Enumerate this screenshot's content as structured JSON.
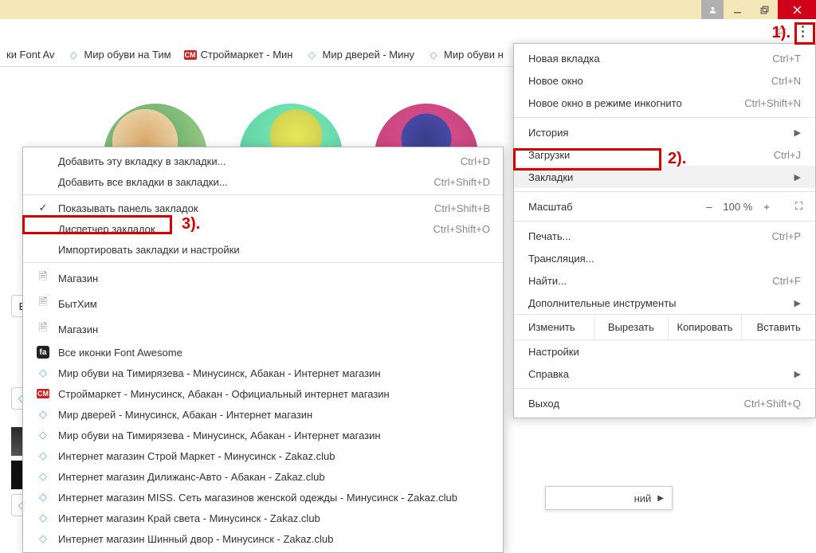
{
  "titlebar": {},
  "urlbar": {},
  "bookmarks_bar": [
    {
      "label": "ки Font Av",
      "icon": "page"
    },
    {
      "label": "Мир обуви на Тим",
      "icon": "diamond"
    },
    {
      "label": "Строймаркет - Мин",
      "icon": "cm"
    },
    {
      "label": "Мир дверей - Мину",
      "icon": "diamond"
    },
    {
      "label": "Мир обуви н",
      "icon": "diamond"
    }
  ],
  "chrome_menu": {
    "new_tab": "Новая вкладка",
    "new_tab_sc": "Ctrl+T",
    "new_window": "Новое окно",
    "new_window_sc": "Ctrl+N",
    "incognito": "Новое окно в режиме инкогнито",
    "incognito_sc": "Ctrl+Shift+N",
    "history": "История",
    "downloads": "Загрузки",
    "downloads_sc": "Ctrl+J",
    "bookmarks": "Закладки",
    "zoom_label": "Масштаб",
    "zoom_value": "100 %",
    "print": "Печать...",
    "print_sc": "Ctrl+P",
    "cast": "Трансляция...",
    "find": "Найти...",
    "find_sc": "Ctrl+F",
    "more_tools": "Дополнительные инструменты",
    "edit_label": "Изменить",
    "cut": "Вырезать",
    "copy": "Копировать",
    "paste": "Вставить",
    "settings": "Настройки",
    "help": "Справка",
    "exit": "Выход",
    "exit_sc": "Ctrl+Shift+Q"
  },
  "bookmarks_menu": {
    "add_tab": "Добавить эту вкладку в закладки...",
    "add_tab_sc": "Ctrl+D",
    "add_all": "Добавить все вкладки в закладки...",
    "add_all_sc": "Ctrl+Shift+D",
    "show_bar": "Показывать панель закладок",
    "show_bar_sc": "Ctrl+Shift+B",
    "manager": "Диспетчер закладок",
    "manager_sc": "Ctrl+Shift+O",
    "import": "Импортировать закладки и настройки",
    "items": [
      {
        "icon": "page",
        "label": "Магазин"
      },
      {
        "icon": "page",
        "label": "БытХим"
      },
      {
        "icon": "page",
        "label": "Магазин"
      },
      {
        "icon": "fa",
        "label": "Все иконки Font Awesome"
      },
      {
        "icon": "diamond",
        "label": "Мир обуви на Тимирязева - Минусинск, Абакан - Интернет магазин"
      },
      {
        "icon": "cm",
        "label": "Строймаркет - Минусинск, Абакан - Официальный интернет магазин"
      },
      {
        "icon": "diamond",
        "label": "Мир дверей - Минусинск, Абакан - Интернет магазин"
      },
      {
        "icon": "diamond",
        "label": "Мир обуви на Тимирязева - Минусинск, Абакан - Интернет магазин"
      },
      {
        "icon": "diamond",
        "label": "Интернет магазин Строй Маркет - Минусинск - Zakaz.club"
      },
      {
        "icon": "diamond",
        "label": "Интернет магазин Дилижанс-Авто - Абакан - Zakaz.club"
      },
      {
        "icon": "diamond",
        "label": "Интернет магазин MISS. Сеть магазинов женской одежды - Минусинск - Zakaz.club"
      },
      {
        "icon": "diamond",
        "label": "Интернет магазин Край света - Минусинск - Zakaz.club"
      },
      {
        "icon": "diamond",
        "label": "Интернет магазин Шинный двор - Минусинск - Zakaz.club"
      }
    ]
  },
  "annotations": {
    "a1": "1).",
    "a2": "2).",
    "a3": "3)."
  },
  "fragment": {
    "text": "ний"
  }
}
